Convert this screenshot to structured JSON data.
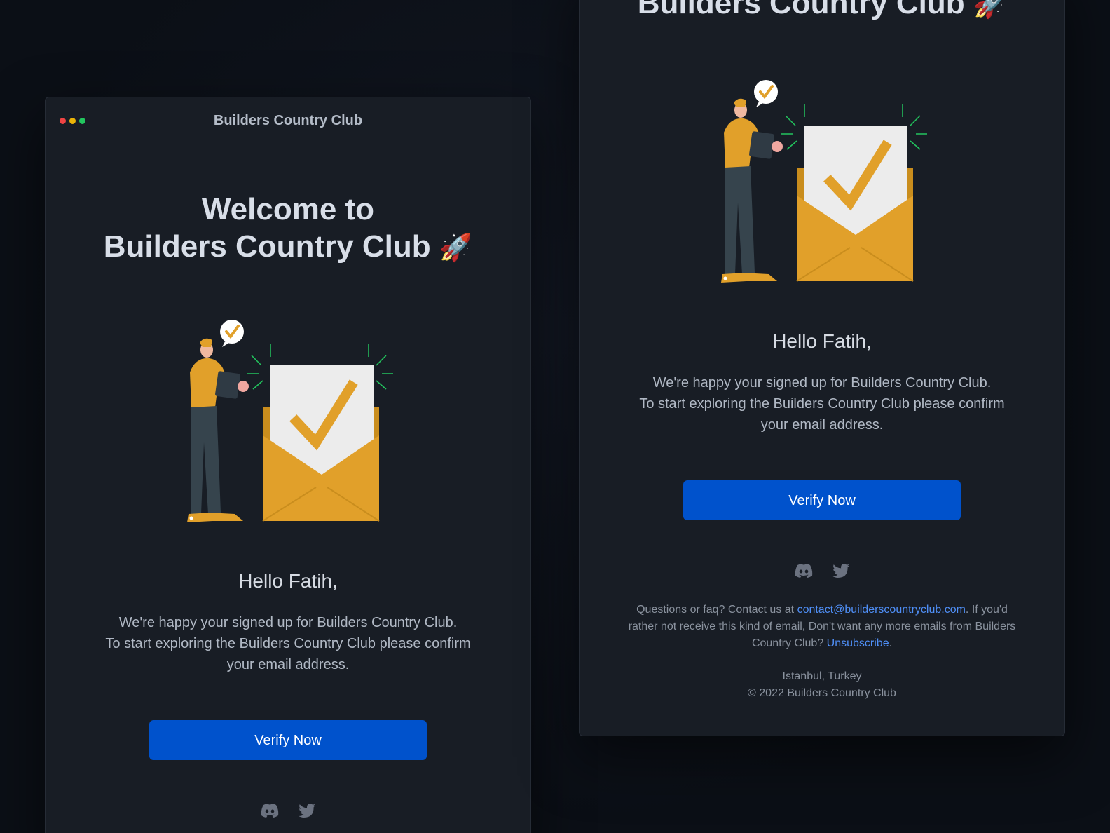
{
  "window": {
    "title": "Builders Country Club"
  },
  "email": {
    "headline_line1": "Welcome to",
    "headline_line2": "Builders Country Club",
    "headline_emoji": "🚀",
    "greeting": "Hello Fatih,",
    "message_line1": "We're happy your signed up for Builders Country Club.",
    "message_line2": "To start exploring the Builders Country Club please confirm your email address.",
    "cta_label": "Verify Now",
    "social": [
      "discord-icon",
      "twitter-icon"
    ],
    "footer_prefix": "Questions or faq? Contact us at ",
    "contact_email": "contact@builderscountryclub.com",
    "footer_middle": ". If you'd rather not receive this kind of email, Don't want any more emails from Builders Country Club? ",
    "unsubscribe_label": "Unsubscribe",
    "footer_suffix": ".",
    "location": "Istanbul, Turkey",
    "copyright": "© 2022 Builders Country Club"
  },
  "colors": {
    "background": "#0c1018",
    "card": "#181d25",
    "button": "#0052cc",
    "link": "#4f8ff7",
    "envelope": "#e1a02a"
  }
}
